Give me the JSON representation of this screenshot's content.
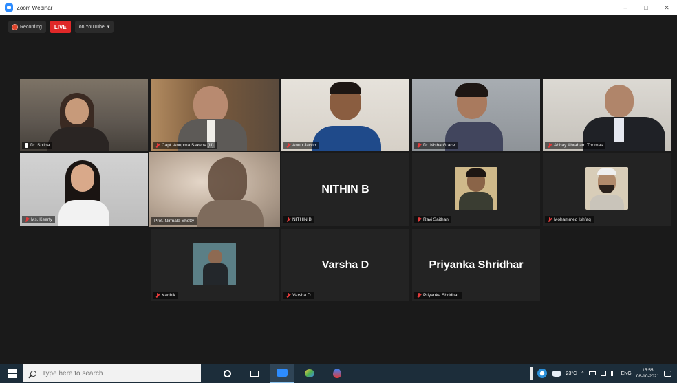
{
  "window": {
    "title": "Zoom Webinar",
    "controls": [
      "–",
      "□",
      "✕"
    ]
  },
  "recording_bar": {
    "recording_label": "Recording",
    "live_label": "LIVE",
    "stream_label": "on YouTube",
    "stream_caret": "▾"
  },
  "participants": [
    {
      "name": "Dr. Shilpa",
      "mic": "on",
      "type": "video",
      "bg": "#6b6156"
    },
    {
      "name": "Capt. Anupma Saxena (ill)",
      "mic": "off",
      "type": "video",
      "bg": "#8a6f52"
    },
    {
      "name": "Anup Jacob",
      "mic": "off",
      "type": "video",
      "bg": "#d8d2c8"
    },
    {
      "name": "Dr. Nisha Grace",
      "mic": "off",
      "type": "video",
      "bg": "#9aa0a6"
    },
    {
      "name": "Abhay Abraham Thomas",
      "mic": "off",
      "type": "video",
      "bg": "#c8c5c0"
    },
    {
      "name": "Ms. Keerty",
      "mic": "off",
      "type": "video",
      "bg": "#c4c4c4"
    },
    {
      "name": "Prof. Nirmala Shetty",
      "mic": "none",
      "type": "video",
      "bg": "#b9a99a",
      "active": true
    },
    {
      "name": "NITHIN B",
      "display": "NITHIN B",
      "mic": "off",
      "type": "name"
    },
    {
      "name": "Ravi Saithan",
      "mic": "off",
      "type": "avatar",
      "bg": "#c8b06a"
    },
    {
      "name": "Mohammed Ishfaq",
      "mic": "off",
      "type": "avatar",
      "bg": "#b8a890"
    },
    {
      "name": "Karthik",
      "mic": "off",
      "type": "avatar",
      "bg": "#6a8a94"
    },
    {
      "name": "Varsha D",
      "display": "Varsha D",
      "mic": "off",
      "type": "name"
    },
    {
      "name": "Priyanka Shridhar",
      "display": "Priyanka Shridhar",
      "mic": "off",
      "type": "name"
    }
  ],
  "taskbar": {
    "search_placeholder": "Type here to search",
    "weather": "23°C",
    "language": "ENG",
    "time": "15:55",
    "date": "08-10-2021"
  }
}
